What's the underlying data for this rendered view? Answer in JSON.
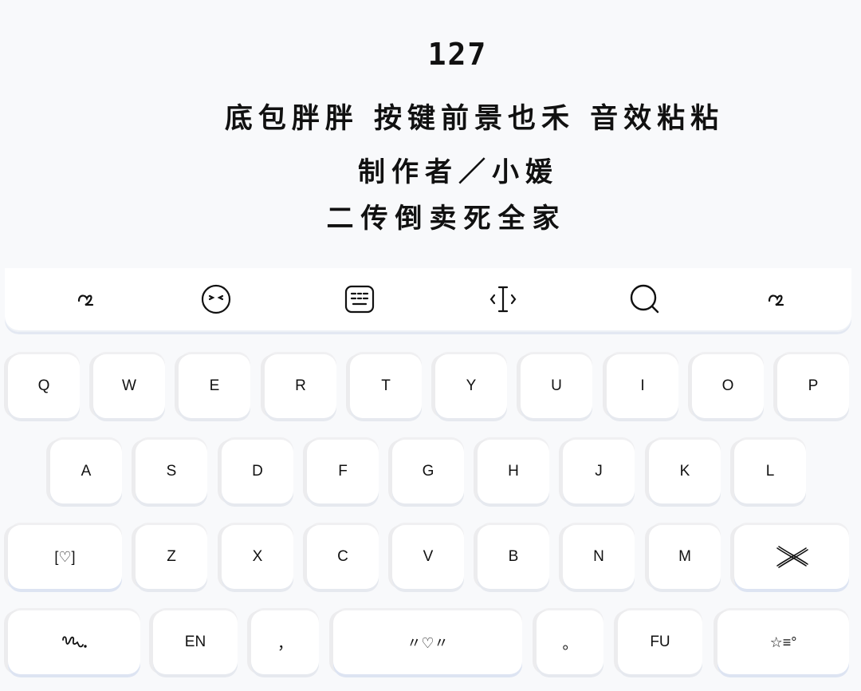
{
  "header": {
    "number": "127",
    "line1": "底包胖胖 按键前景也禾 音效粘粘",
    "line2": "制作者／小媛",
    "line3": "二传倒卖死全家"
  },
  "toolbar": {
    "items": [
      {
        "name": "handwriting-squiggle-icon"
      },
      {
        "name": "emoji-face-icon"
      },
      {
        "name": "keyboard-icon"
      },
      {
        "name": "cursor-move-icon"
      },
      {
        "name": "search-icon"
      },
      {
        "name": "collapse-squiggle-icon"
      }
    ]
  },
  "keys": {
    "row1": [
      "Q",
      "W",
      "E",
      "R",
      "T",
      "Y",
      "U",
      "I",
      "O",
      "P"
    ],
    "row2": [
      "A",
      "S",
      "D",
      "F",
      "G",
      "H",
      "J",
      "K",
      "L"
    ],
    "row3": {
      "left": "[♡]",
      "letters": [
        "Z",
        "X",
        "C",
        "V",
        "B",
        "N",
        "M"
      ],
      "delete_icon": "delete-cross-icon"
    },
    "row4": {
      "symbols_icon": "handwriting-icon",
      "lang": "EN",
      "comma": "，",
      "space": "〃♡〃",
      "period": "。",
      "fu": "FU",
      "enter": "☆≡°"
    }
  }
}
